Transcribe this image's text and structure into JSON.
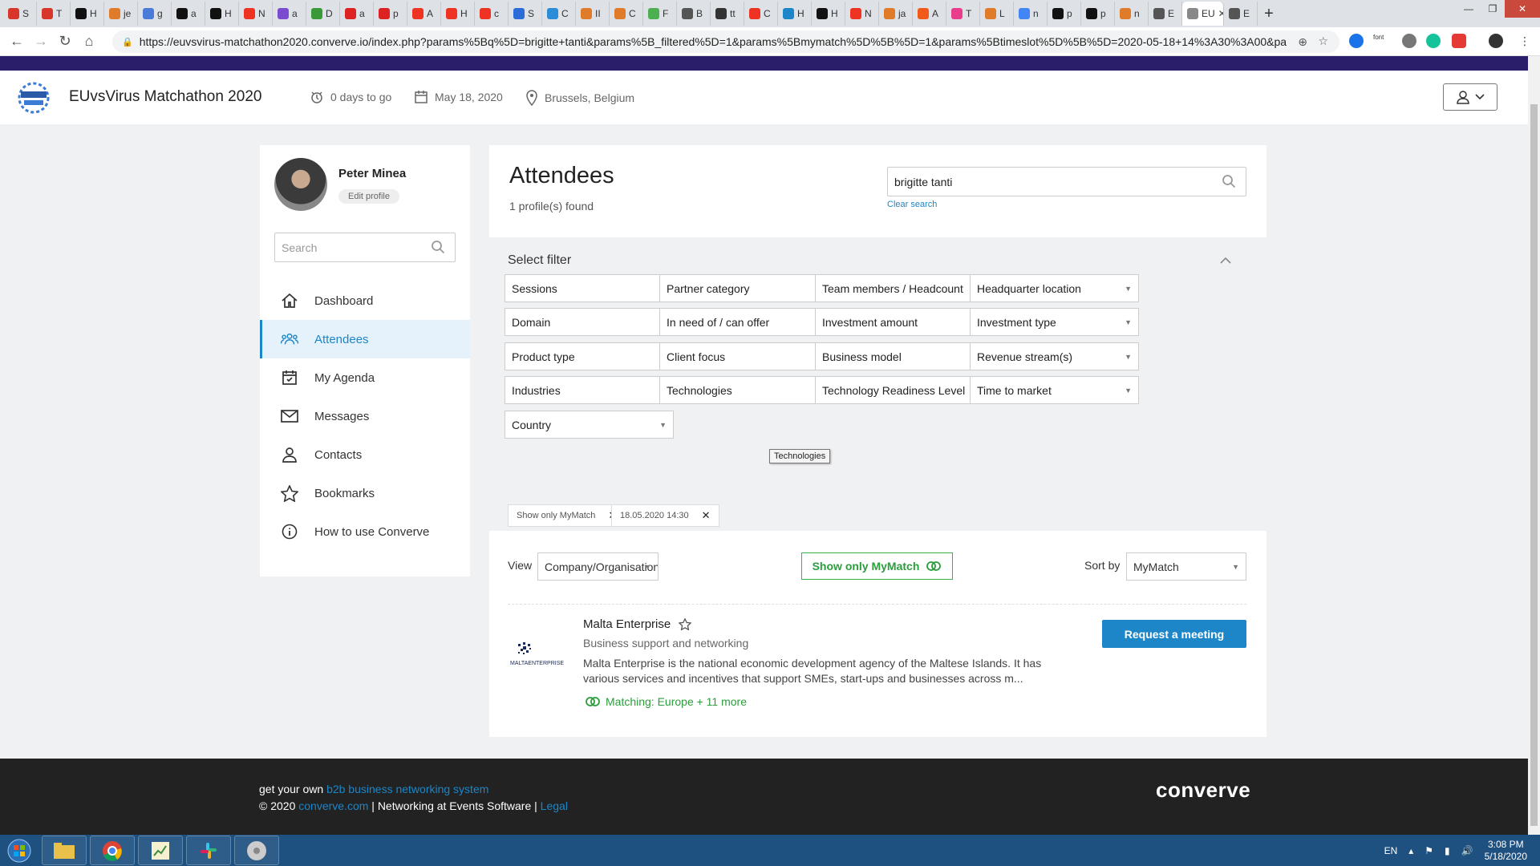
{
  "browser": {
    "tabs": [
      {
        "t": "S",
        "c": "#d9362b"
      },
      {
        "t": "T",
        "c": "#d9362b"
      },
      {
        "t": "H",
        "c": "#111"
      },
      {
        "t": "je",
        "c": "#e07b2a"
      },
      {
        "t": "g",
        "c": "#4a7bd8"
      },
      {
        "t": "a",
        "c": "#111"
      },
      {
        "t": "H",
        "c": "#111"
      },
      {
        "t": "N",
        "c": "#e32"
      },
      {
        "t": "a",
        "c": "#7b4bd0"
      },
      {
        "t": "D",
        "c": "#3a9a3a"
      },
      {
        "t": "a",
        "c": "#d22"
      },
      {
        "t": "p",
        "c": "#d22"
      },
      {
        "t": "A",
        "c": "#e32"
      },
      {
        "t": "H",
        "c": "#e32"
      },
      {
        "t": "c",
        "c": "#e32"
      },
      {
        "t": "S",
        "c": "#2b6cd8"
      },
      {
        "t": "C",
        "c": "#2b8cd8"
      },
      {
        "t": "II",
        "c": "#e07b2a"
      },
      {
        "t": "C",
        "c": "#e07b2a"
      },
      {
        "t": "F",
        "c": "#4caf50"
      },
      {
        "t": "B",
        "c": "#555"
      },
      {
        "t": "tt",
        "c": "#333"
      },
      {
        "t": "C",
        "c": "#e32"
      },
      {
        "t": "H",
        "c": "#1c86c8"
      },
      {
        "t": "H",
        "c": "#111"
      },
      {
        "t": "N",
        "c": "#e32"
      },
      {
        "t": "ja",
        "c": "#e07b2a"
      },
      {
        "t": "A",
        "c": "#f25a1c"
      },
      {
        "t": "T",
        "c": "#e83e8c"
      },
      {
        "t": "L",
        "c": "#e07b2a"
      },
      {
        "t": "n",
        "c": "#4285f4"
      },
      {
        "t": "p",
        "c": "#111"
      },
      {
        "t": "p",
        "c": "#111"
      },
      {
        "t": "n",
        "c": "#e07b2a"
      },
      {
        "t": "E",
        "c": "#555"
      },
      {
        "t": "EU",
        "c": "#888"
      },
      {
        "t": "E",
        "c": "#555"
      }
    ],
    "url": "https://euvsvirus-matchathon2020.converve.io/index.php?params%5Bq%5D=brigitte+tanti&params%5B_filtered%5D=1&params%5Bmymatch%5D%5B%5D=1&params%5Btimeslot%5D%5B%5D=2020-05-18+14%3A30%3A00&para"
  },
  "header": {
    "event_title": "EUvsVirus Matchathon 2020",
    "countdown": "0 days to go",
    "date": "May 18, 2020",
    "location": "Brussels, Belgium"
  },
  "sidebar": {
    "user_name": "Peter Minea",
    "edit_profile": "Edit profile",
    "search_placeholder": "Search",
    "items": [
      {
        "label": "Dashboard",
        "icon": "home-icon"
      },
      {
        "label": "Attendees",
        "icon": "people-icon"
      },
      {
        "label": "My Agenda",
        "icon": "calendar-icon"
      },
      {
        "label": "Messages",
        "icon": "envelope-icon"
      },
      {
        "label": "Contacts",
        "icon": "person-icon"
      },
      {
        "label": "Bookmarks",
        "icon": "star-icon"
      },
      {
        "label": "How to use Converve",
        "icon": "info-icon"
      }
    ]
  },
  "main": {
    "title": "Attendees",
    "found": "1 profile(s) found",
    "search_value": "brigitte tanti",
    "clear_search": "Clear search",
    "filter_title": "Select filter",
    "filters": [
      "Sessions",
      "Partner category",
      "Team members / Headcount",
      "Headquarter location",
      "Domain",
      "In need of / can offer",
      "Investment amount",
      "Investment type",
      "Product type",
      "Client focus",
      "Business model",
      "Revenue stream(s)",
      "Industries",
      "Technologies",
      "Technology Readiness Level",
      "Time to market",
      "Country"
    ],
    "tooltip": "Technologies",
    "chips": [
      "Show only MyMatch",
      "18.05.2020 14:30"
    ],
    "view_label": "View",
    "view_value": "Company/Organisation",
    "mymatch_button": "Show only MyMatch",
    "sort_label": "Sort by",
    "sort_value": "MyMatch",
    "result": {
      "name": "Malta Enterprise",
      "category": "Business support and networking",
      "description": "Malta Enterprise is the national economic development agency of the Maltese Islands. It has various services and incentives that support SMEs, start-ups and businesses across m...",
      "matching": "Matching: Europe + 11 more",
      "logo_text": "MALTAENTERPRISE",
      "request_button": "Request a meeting"
    }
  },
  "footer": {
    "line1_prefix": "get your own",
    "line1_link": "b2b business networking system",
    "line2_prefix": "© 2020",
    "line2_link": "converve.com",
    "line2_mid": "| Networking at Events Software |",
    "line2_legal": "Legal",
    "brand": "converve"
  },
  "taskbar": {
    "lang": "EN",
    "time": "3:08 PM",
    "date": "5/18/2020"
  },
  "colors": {
    "accent": "#1c86c8",
    "match_green": "#2b9e3c",
    "header_band": "#2a1e6b"
  }
}
